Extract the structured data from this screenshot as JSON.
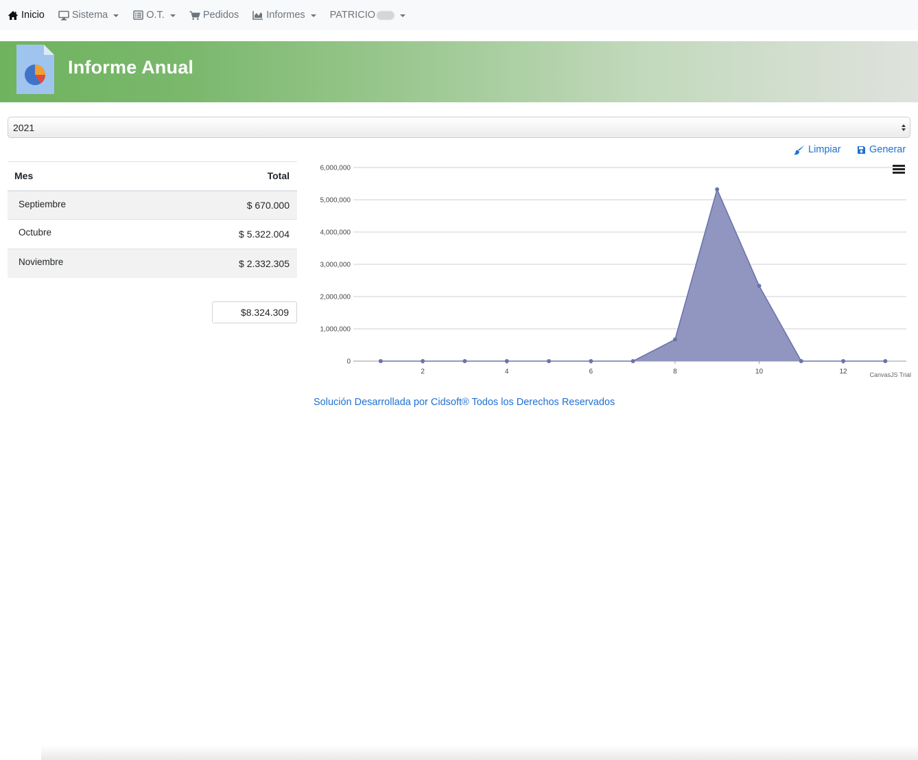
{
  "nav": {
    "inicio": "Inicio",
    "sistema": "Sistema",
    "ot": "O.T.",
    "pedidos": "Pedidos",
    "informes": "Informes",
    "user": "PATRICIO"
  },
  "banner": {
    "title": "Informe Anual"
  },
  "year_select": {
    "value": "2021"
  },
  "actions": {
    "limpiar": "Limpiar",
    "generar": "Generar"
  },
  "table": {
    "headers": {
      "mes": "Mes",
      "total": "Total"
    },
    "rows": [
      {
        "mes": "Septiembre",
        "total": "$ 670.000"
      },
      {
        "mes": "Octubre",
        "total": "$ 5.322.004"
      },
      {
        "mes": "Noviembre",
        "total": "$ 2.332.305"
      }
    ],
    "grand_total": "$8.324.309"
  },
  "colors": {
    "accent": "#1f6fd1",
    "banner_green": "#6fb35f",
    "area_fill": "#9196c0",
    "area_line": "#6b73ab"
  },
  "chart_data": {
    "type": "area",
    "x": [
      1,
      2,
      3,
      4,
      5,
      6,
      7,
      8,
      9,
      10,
      11,
      12,
      13
    ],
    "y": [
      0,
      0,
      0,
      0,
      0,
      0,
      0,
      670000,
      5322004,
      2332305,
      0,
      0,
      0
    ],
    "x_ticks": [
      "2",
      "4",
      "6",
      "8",
      "10",
      "12"
    ],
    "y_ticks": [
      "0",
      "1,000,000",
      "2,000,000",
      "3,000,000",
      "4,000,000",
      "5,000,000",
      "6,000,000"
    ],
    "ylim": [
      0,
      6000000
    ],
    "grid": true,
    "credit": "CanvasJS Trial"
  },
  "footer": {
    "text": "Solución Desarrollada por Cidsoft® Todos los Derechos Reservados"
  }
}
